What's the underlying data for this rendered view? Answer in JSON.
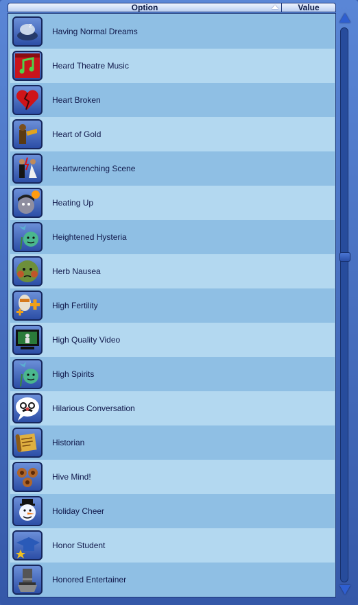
{
  "header": {
    "option_label": "Option",
    "value_label": "Value"
  },
  "colors": {
    "row_dark": "#8fbfe4",
    "row_light": "#b3d8f0",
    "frame": "#3a5fb0",
    "text": "#10184a"
  },
  "items": [
    {
      "label": "Having Normal Dreams",
      "icon": "dreams-icon"
    },
    {
      "label": "Heard Theatre Music",
      "icon": "theatre-music-icon"
    },
    {
      "label": "Heart Broken",
      "icon": "broken-heart-icon"
    },
    {
      "label": "Heart of Gold",
      "icon": "heart-of-gold-icon"
    },
    {
      "label": "Heartwrenching Scene",
      "icon": "wedding-couple-icon"
    },
    {
      "label": "Heating Up",
      "icon": "vampire-sun-icon"
    },
    {
      "label": "Heightened Hysteria",
      "icon": "plant-face-icon"
    },
    {
      "label": "Herb Nausea",
      "icon": "sick-face-icon"
    },
    {
      "label": "High Fertility",
      "icon": "fertility-plus-icon"
    },
    {
      "label": "High Quality Video",
      "icon": "monitor-icon"
    },
    {
      "label": "High Spirits",
      "icon": "plant-face-icon"
    },
    {
      "label": "Hilarious Conversation",
      "icon": "speech-bubble-disguise-icon"
    },
    {
      "label": "Historian",
      "icon": "scroll-icon"
    },
    {
      "label": "Hive Mind!",
      "icon": "hive-icon"
    },
    {
      "label": "Holiday Cheer",
      "icon": "snowman-icon"
    },
    {
      "label": "Honor Student",
      "icon": "graduation-cap-icon"
    },
    {
      "label": "Honored Entertainer",
      "icon": "top-hat-icon"
    }
  ]
}
